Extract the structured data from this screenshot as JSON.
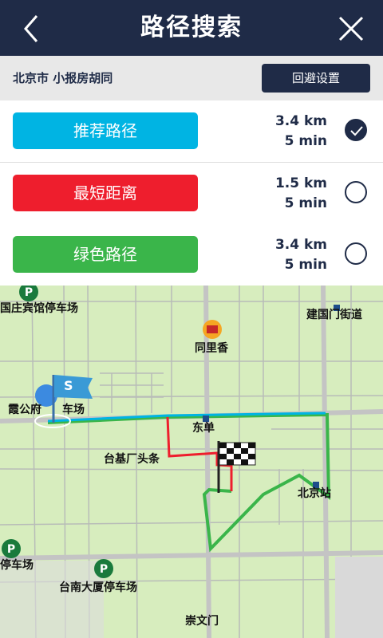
{
  "header": {
    "title": "路径搜索",
    "back_icon": "chevron-left-icon",
    "close_icon": "close-icon"
  },
  "address_bar": {
    "address": "北京市 小报房胡同",
    "avoid_button": "回避设置"
  },
  "routes": [
    {
      "label": "推荐路径",
      "distance": "3.4 km",
      "time": "5 min",
      "color": "#00b4e3",
      "selected": true
    },
    {
      "label": "最短距离",
      "distance": "1.5 km",
      "time": "5 min",
      "color": "#ee1e2d",
      "selected": false
    },
    {
      "label": "绿色路径",
      "distance": "3.4 km",
      "time": "5 min",
      "color": "#3ab54a",
      "selected": false
    }
  ],
  "map": {
    "labels": {
      "jianguomen": "建国门街道",
      "tonglixiang": "同里香",
      "dongdan": "东单",
      "taijichang": "台基厂头条",
      "beijingzhan": "北京站",
      "xiagongfu": "霞公府",
      "xiagongfu_park": "车场",
      "binguan": "国庄宾馆停车场",
      "tingchechang_left": "停车场",
      "tainan": "台南大厦停车场",
      "chongwenmen": "崇文门"
    },
    "start_flag_text": "S"
  }
}
